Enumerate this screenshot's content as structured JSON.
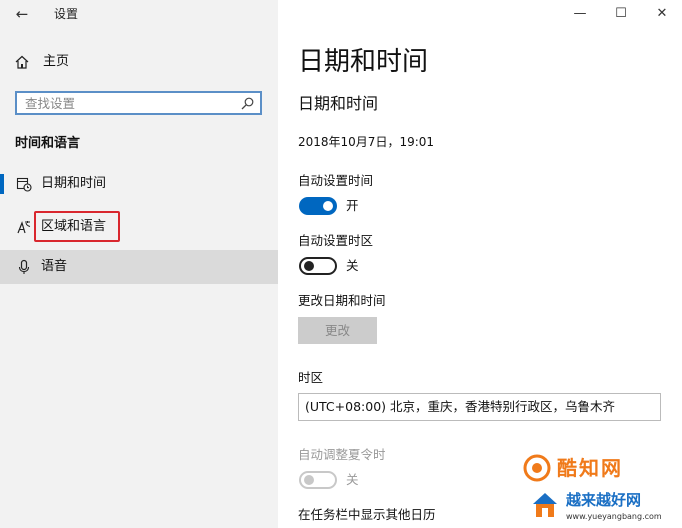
{
  "window": {
    "title": "设置",
    "back_glyph": "←",
    "minimize_glyph": "—",
    "maximize_glyph": "☐",
    "close_glyph": "✕"
  },
  "sidebar": {
    "home_label": "主页",
    "search_placeholder": "查找设置",
    "section_title": "时间和语言",
    "items": [
      {
        "label": "日期和时间",
        "icon": "calendar-clock-icon",
        "active": true
      },
      {
        "label": "区域和语言",
        "icon": "language-icon",
        "highlighted": true
      },
      {
        "label": "语音",
        "icon": "microphone-icon"
      }
    ]
  },
  "main": {
    "page_title": "日期和时间",
    "sub_title": "日期和时间",
    "current_datetime": "2018年10月7日，19:01",
    "auto_time": {
      "label": "自动设置时间",
      "state": "开",
      "on": true
    },
    "auto_timezone": {
      "label": "自动设置时区",
      "state": "关",
      "on": false
    },
    "change_datetime": {
      "label": "更改日期和时间",
      "button": "更改"
    },
    "timezone": {
      "label": "时区",
      "value": "(UTC+08:00) 北京，重庆，香港特别行政区，乌鲁木齐"
    },
    "dst": {
      "label": "自动调整夏令时",
      "state": "关",
      "disabled": true
    },
    "taskbar_calendar_label": "在任务栏中显示其他日历"
  },
  "watermark": {
    "text1": "酷知网",
    "text2": "越来越好网",
    "url": "www.yueyangbang.com",
    "accent_orange": "#f07a1a",
    "accent_blue": "#1a6fc4"
  },
  "colors": {
    "accent": "#0067c0",
    "sidebar_bg": "#f2f2f2",
    "highlight_red": "#d9272e"
  }
}
